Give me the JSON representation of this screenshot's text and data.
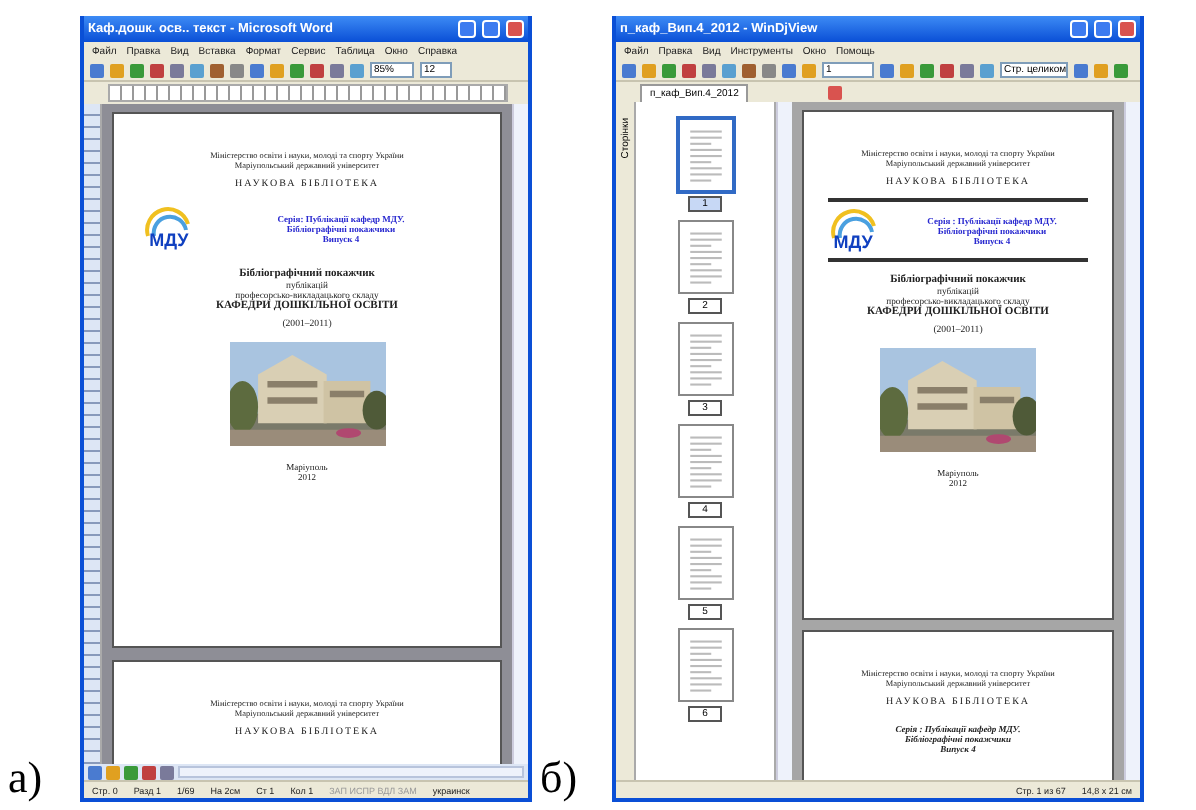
{
  "word": {
    "label": "а)",
    "title": "Каф.дошк. осв.. текст - Microsoft Word",
    "menu": [
      "Файл",
      "Правка",
      "Вид",
      "Вставка",
      "Формат",
      "Сервис",
      "Таблица",
      "Окно",
      "Справка"
    ],
    "zoom": "85%",
    "font_size": "12",
    "pages": [
      {
        "ministry": [
          "Міністерство освіти і науки, молоді та спорту України",
          "Маріупольський державний університет"
        ],
        "library": "НАУКОВА  БІБЛІОТЕКА",
        "logo": "МДУ",
        "series": [
          "Серія: Публікації кафедр МДУ.",
          "Бібліографічні покажчики",
          "Випуск 4"
        ],
        "heading": [
          "Бібліографічний покажчик",
          "публікацій",
          "професорсько-викладацького складу",
          "КАФЕДРИ ДОШКІЛЬНОЇ ОСВІТИ"
        ],
        "years": "(2001–2011)",
        "city": "Маріуполь",
        "year": "2012"
      },
      {
        "ministry": [
          "Міністерство освіти і науки, молоді та спорту України",
          "Маріупольський державний університет"
        ],
        "library": "НАУКОВА  БІБЛІОТЕКА"
      }
    ],
    "status": [
      "Стр. 0",
      "Разд 1",
      "1/69",
      "На 2см",
      "Ст 1",
      "Кол 1",
      "ЗАП ИСПР ВДЛ ЗАМ",
      "украинск"
    ]
  },
  "djview": {
    "label": "б)",
    "title": "п_каф_Вип.4_2012 - WinDjView",
    "menu": [
      "Файл",
      "Правка",
      "Вид",
      "Инструменты",
      "Окно",
      "Помощь"
    ],
    "page_field": "1",
    "zoom": "Стр. целиком",
    "tab": "п_каф_Вип.4_2012",
    "side_tab": "Сторінки",
    "thumbnails": [
      {
        "number": "1",
        "selected": true
      },
      {
        "number": "2",
        "selected": false
      },
      {
        "number": "3",
        "selected": false
      },
      {
        "number": "4",
        "selected": false
      },
      {
        "number": "5",
        "selected": false
      },
      {
        "number": "6",
        "selected": false
      }
    ],
    "pages": [
      {
        "ministry": [
          "Міністерство освіти і науки, молоді та спорту України",
          "Маріупольський державний університет"
        ],
        "library": "НАУКОВА  БІБЛІОТЕКА",
        "logo": "МДУ",
        "series": [
          "Серія : Публікації кафедр МДУ.",
          "Бібліографічні покажчики",
          "Випуск 4"
        ],
        "heading": [
          "Бібліографічний покажчик",
          "публікацій",
          "професорсько-викладацького складу",
          "КАФЕДРИ ДОШКІЛЬНОЇ ОСВІТИ"
        ],
        "years": "(2001–2011)",
        "city": "Маріуполь",
        "year": "2012"
      },
      {
        "ministry": [
          "Міністерство освіти і науки, молоді та спорту України",
          "Маріупольський державний університет"
        ],
        "library": "НАУКОВА  БІБЛІОТЕКА",
        "series": [
          "Серія : Публікації кафедр МДУ.",
          "Бібліографічні покажчики",
          "Випуск 4"
        ]
      }
    ],
    "status": [
      "Стр. 1 из 67",
      "14,8 x 21 см"
    ]
  }
}
